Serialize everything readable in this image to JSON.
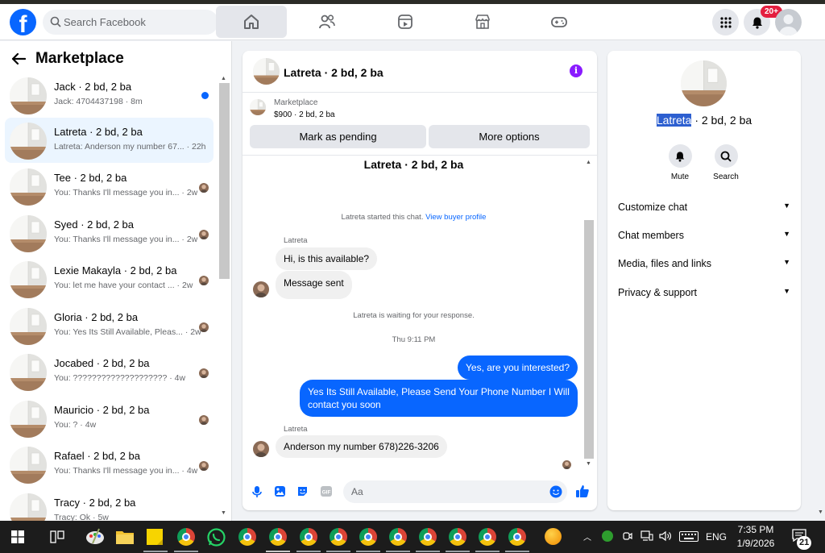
{
  "topnav": {
    "search_placeholder": "Search Facebook",
    "notification_badge": "20+"
  },
  "sidebar": {
    "title": "Marketplace",
    "conversations": [
      {
        "name": "Jack · 2 bd, 2 ba",
        "snippet": "Jack: 4704437198 · 8m",
        "unread": true
      },
      {
        "name": "Latreta · 2 bd, 2 ba",
        "snippet": "Latreta: Anderson my number 67... · 22h",
        "active": true
      },
      {
        "name": "Tee · 2 bd, 2 ba",
        "snippet": "You: Thanks I'll message you in... · 2w"
      },
      {
        "name": "Syed · 2 bd, 2 ba",
        "snippet": "You: Thanks I'll message you in... · 2w"
      },
      {
        "name": "Lexie Makayla · 2 bd, 2 ba",
        "snippet": "You: let me have your contact ... · 2w"
      },
      {
        "name": "Gloria · 2 bd, 2 ba",
        "snippet": "You: Yes Its Still Available, Pleas... · 2w"
      },
      {
        "name": "Jocabed · 2 bd, 2 ba",
        "snippet": "You: ???????????????????? · 4w"
      },
      {
        "name": "Mauricio · 2 bd, 2 ba",
        "snippet": "You: ? · 4w"
      },
      {
        "name": "Rafael · 2 bd, 2 ba",
        "snippet": "You: Thanks I'll message you in... · 4w"
      },
      {
        "name": "Tracy · 2 bd, 2 ba",
        "snippet": "Tracy: Ok · 5w"
      }
    ]
  },
  "chat": {
    "title": "Latreta · 2 bd, 2 ba",
    "listing": {
      "label": "Marketplace",
      "price": "$900 · 2 bd, 2 ba",
      "mark_pending": "Mark as pending",
      "more_options": "More options"
    },
    "conversation_title": "Latreta · 2 bd, 2 ba",
    "started_text": "Latreta started this chat.",
    "view_profile": "View buyer profile",
    "sender_1": "Latreta",
    "msg_1": "Hi, is this available?",
    "msg_2": "Message sent",
    "waiting_text": "Latreta is waiting for your response.",
    "timestamp": "Thu 9:11 PM",
    "msg_out_1": "Yes, are you interested?",
    "msg_out_2": "Yes Its Still Available, Please Send Your Phone Number I Will contact you soon",
    "sender_2": "Latreta",
    "msg_3": "Anderson my number 678)226-3206",
    "composer_placeholder": "Aa"
  },
  "rightpanel": {
    "name_highlight": "Latreta",
    "name_rest": " · 2 bd, 2 ba",
    "mute_label": "Mute",
    "search_label": "Search",
    "rows": [
      "Customize chat",
      "Chat members",
      "Media, files and links",
      "Privacy & support"
    ]
  },
  "taskbar": {
    "language": "ENG",
    "time": "7:35 PM",
    "date": "1/9/2026",
    "notif_count": "21"
  },
  "colors": {
    "accent": "#0866ff",
    "bubble_in": "#f0f0f0",
    "info": "#8a1bff"
  }
}
